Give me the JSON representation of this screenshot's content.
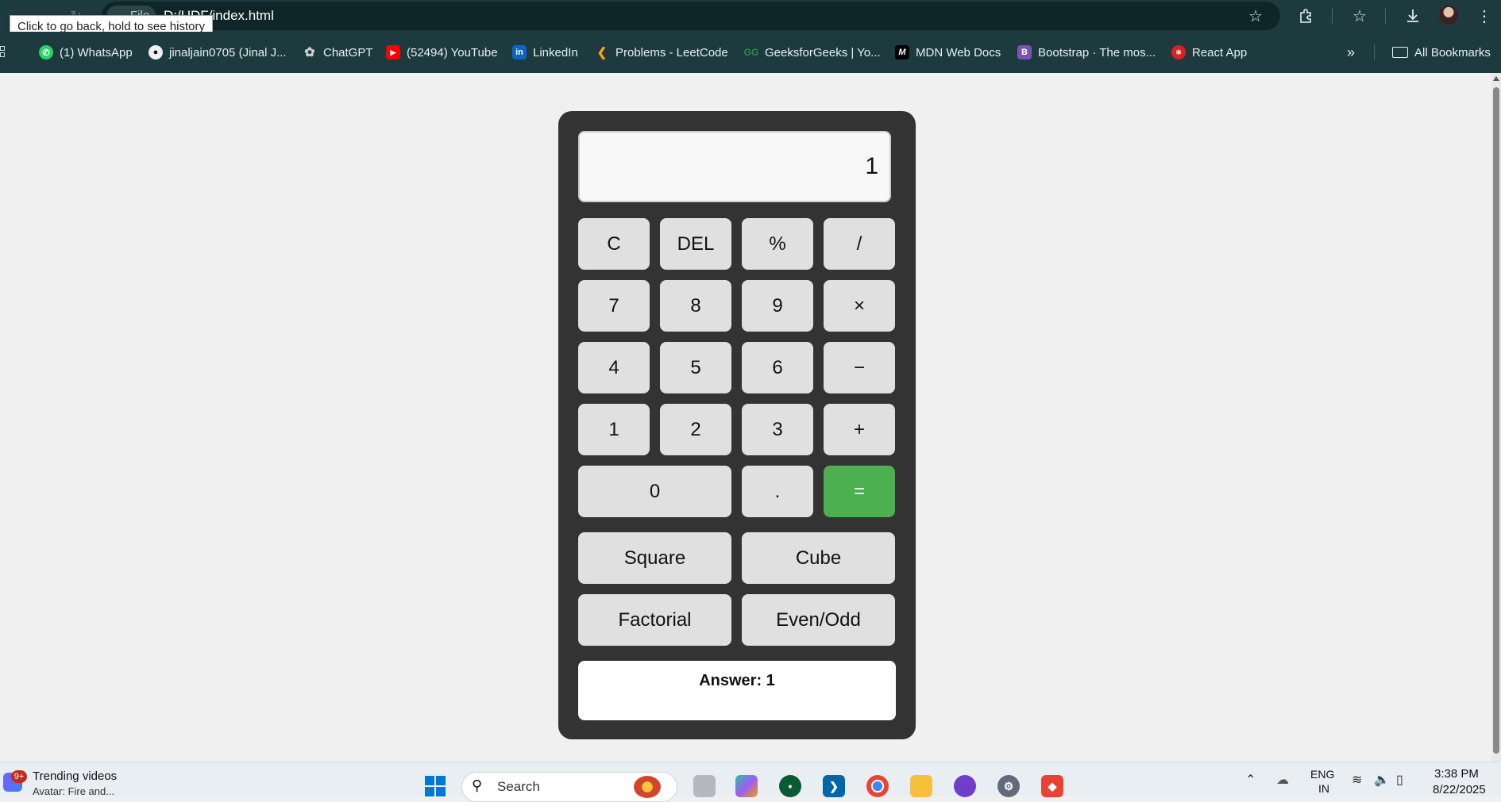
{
  "browser": {
    "site_chip": "File",
    "url": "D:/UDF/index.html",
    "tooltip": "Click to go back, hold to see history"
  },
  "bookmarks": [
    {
      "label": "(1) WhatsApp",
      "icon": "whatsapp-icon",
      "color": "#25d366"
    },
    {
      "label": "jinaljain0705 (Jinal J...",
      "icon": "github-icon",
      "color": "#ffffff"
    },
    {
      "label": "ChatGPT",
      "icon": "chatgpt-icon",
      "color": "#d0d0d0"
    },
    {
      "label": "(52494) YouTube",
      "icon": "youtube-icon",
      "color": "#ff0000"
    },
    {
      "label": "LinkedIn",
      "icon": "linkedin-icon",
      "color": "#0a66c2"
    },
    {
      "label": "Problems - LeetCode",
      "icon": "leetcode-icon",
      "color": "#ffa116"
    },
    {
      "label": "GeeksforGeeks | Yo...",
      "icon": "geeksforgeeks-icon",
      "color": "#2f8d46"
    },
    {
      "label": "MDN Web Docs",
      "icon": "mdn-icon",
      "color": "#000000"
    },
    {
      "label": "Bootstrap · The mos...",
      "icon": "bootstrap-icon",
      "color": "#7952b3"
    },
    {
      "label": "React App",
      "icon": "react-icon",
      "color": "#e02020"
    }
  ],
  "all_bookmarks_label": "All Bookmarks",
  "calculator": {
    "display_value": "1",
    "buttons": {
      "clear": "C",
      "delete": "DEL",
      "percent": "%",
      "divide": "/",
      "seven": "7",
      "eight": "8",
      "nine": "9",
      "multiply": "×",
      "four": "4",
      "five": "5",
      "six": "6",
      "subtract": "−",
      "one": "1",
      "two": "2",
      "three": "3",
      "add": "+",
      "zero": "0",
      "decimal": ".",
      "equals": "="
    },
    "functions": {
      "square": "Square",
      "cube": "Cube",
      "factorial": "Factorial",
      "even_odd": "Even/Odd"
    },
    "answer": "Answer: 1",
    "accent_color": "#4caf50"
  },
  "taskbar": {
    "widget_badge": "9+",
    "widget_title": "Trending videos",
    "widget_subtitle": "Avatar: Fire and...",
    "search_placeholder": "Search",
    "language_top": "ENG",
    "language_bottom": "IN",
    "time": "3:38 PM",
    "date": "8/22/2025"
  }
}
